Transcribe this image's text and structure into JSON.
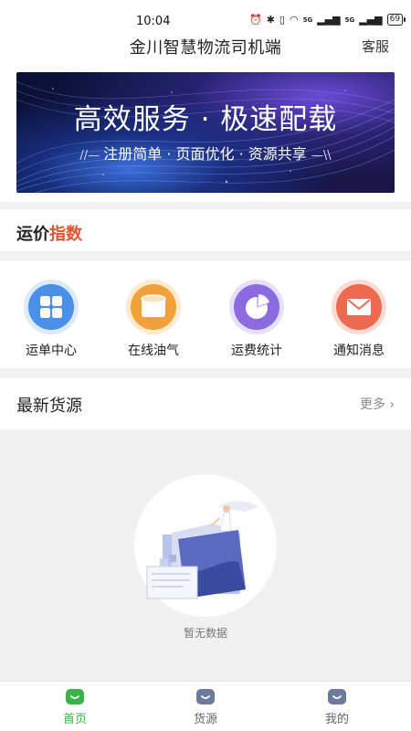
{
  "status_bar": {
    "time": "10:04",
    "network_label": "5G",
    "battery": "69"
  },
  "header": {
    "title": "金川智慧物流司机端",
    "service": "客服"
  },
  "banner": {
    "title": "高效服务 · 极速配载",
    "subtitle": "注册简单 · 页面优化 · 资源共享"
  },
  "freight_index": {
    "label_part1": "运价",
    "label_part2": "指数",
    "accent_color": "#e4532c"
  },
  "quick_menu": [
    {
      "label": "运单中心",
      "icon": "grid-icon",
      "color": "#4a90e8"
    },
    {
      "label": "在线油气",
      "icon": "fuel-icon",
      "color": "#f0a23a"
    },
    {
      "label": "运费统计",
      "icon": "pie-chart-icon",
      "color": "#8a6be0"
    },
    {
      "label": "通知消息",
      "icon": "mail-icon",
      "color": "#ec6a4f"
    }
  ],
  "latest_cargo": {
    "title": "最新货源",
    "more": "更多"
  },
  "empty_state": {
    "text": "暂无数据"
  },
  "tab_bar": {
    "active_color": "#3bb34a",
    "tabs": [
      {
        "label": "首页",
        "icon": "home-icon",
        "active": true
      },
      {
        "label": "货源",
        "icon": "cargo-icon",
        "active": false
      },
      {
        "label": "我的",
        "icon": "profile-icon",
        "active": false
      }
    ]
  }
}
